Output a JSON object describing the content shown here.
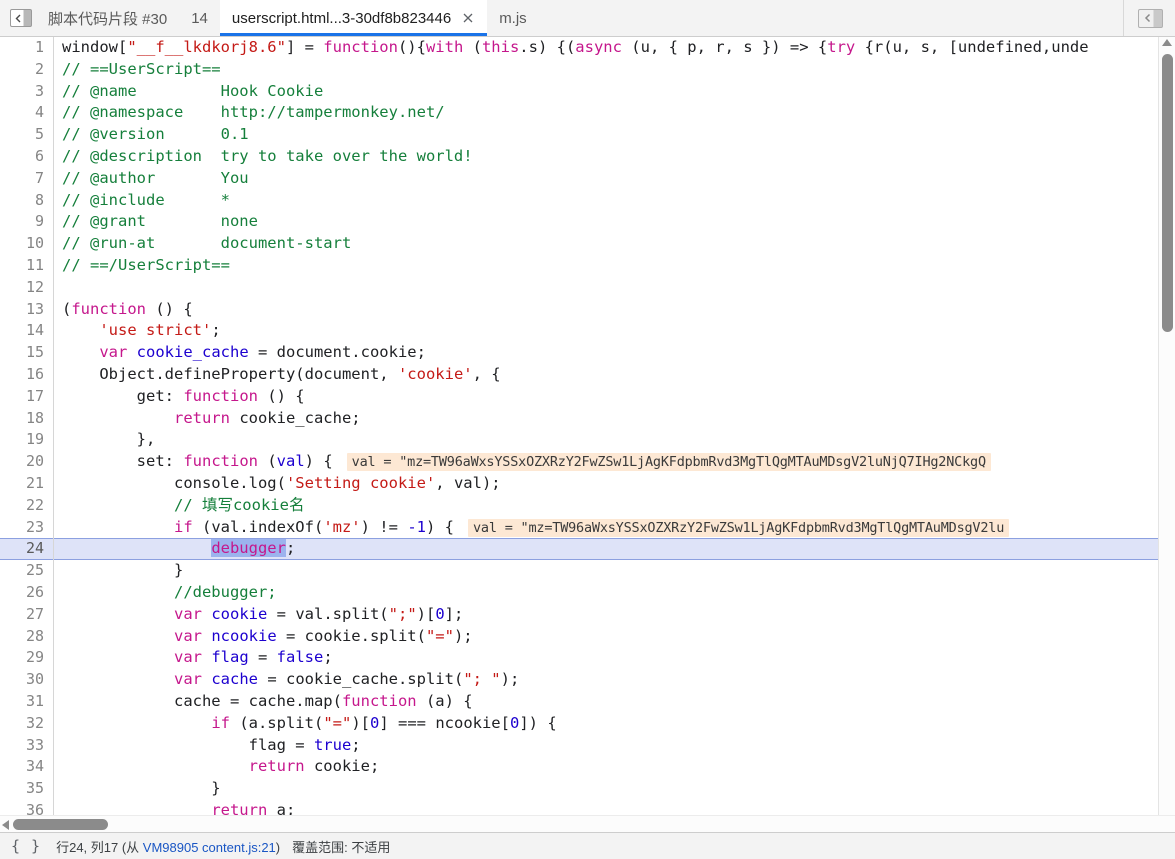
{
  "tabbar": {
    "panel_toggle_icon": "show-navigator-icon",
    "tabs": [
      {
        "label": "脚本代码片段 #30",
        "active": false,
        "closable": false
      },
      {
        "label": "14",
        "active": false,
        "closable": false
      },
      {
        "label": "userscript.html...3-30df8b823446",
        "active": true,
        "closable": true
      },
      {
        "label": "m.js",
        "active": false,
        "closable": false
      }
    ],
    "close_glyph": "✕",
    "collapse_icon": "collapse-sidebar-icon"
  },
  "editor": {
    "current_line": 24,
    "lines": [
      {
        "n": "1",
        "tokens": [
          {
            "t": "window[",
            "c": "t-plain"
          },
          {
            "t": "\"__f__lkdkorj8.6\"",
            "c": "t-str"
          },
          {
            "t": "] = ",
            "c": "t-plain"
          },
          {
            "t": "function",
            "c": "t-kw"
          },
          {
            "t": "(){",
            "c": "t-plain"
          },
          {
            "t": "with",
            "c": "t-kw"
          },
          {
            "t": " (",
            "c": "t-plain"
          },
          {
            "t": "this",
            "c": "t-kw"
          },
          {
            "t": ".s) {(",
            "c": "t-plain"
          },
          {
            "t": "async",
            "c": "t-kw"
          },
          {
            "t": " (u, { p, r, s }) => {",
            "c": "t-plain"
          },
          {
            "t": "try",
            "c": "t-kw"
          },
          {
            "t": " {r(u, s, [undefined,unde",
            "c": "t-plain"
          }
        ]
      },
      {
        "n": "2",
        "tokens": [
          {
            "t": "// ==UserScript==",
            "c": "t-cmt"
          }
        ]
      },
      {
        "n": "3",
        "tokens": [
          {
            "t": "// @name         Hook Cookie",
            "c": "t-cmt"
          }
        ]
      },
      {
        "n": "4",
        "tokens": [
          {
            "t": "// @namespace    http://tampermonkey.net/",
            "c": "t-cmt"
          }
        ]
      },
      {
        "n": "5",
        "tokens": [
          {
            "t": "// @version      0.1",
            "c": "t-cmt"
          }
        ]
      },
      {
        "n": "6",
        "tokens": [
          {
            "t": "// @description  try to take over the world!",
            "c": "t-cmt"
          }
        ]
      },
      {
        "n": "7",
        "tokens": [
          {
            "t": "// @author       You",
            "c": "t-cmt"
          }
        ]
      },
      {
        "n": "8",
        "tokens": [
          {
            "t": "// @include      *",
            "c": "t-cmt"
          }
        ]
      },
      {
        "n": "9",
        "tokens": [
          {
            "t": "// @grant        none",
            "c": "t-cmt"
          }
        ]
      },
      {
        "n": "10",
        "tokens": [
          {
            "t": "// @run-at       document-start",
            "c": "t-cmt"
          }
        ]
      },
      {
        "n": "11",
        "tokens": [
          {
            "t": "// ==/UserScript==",
            "c": "t-cmt"
          }
        ]
      },
      {
        "n": "12",
        "tokens": [
          {
            "t": "",
            "c": "t-plain"
          }
        ]
      },
      {
        "n": "13",
        "tokens": [
          {
            "t": "(",
            "c": "t-plain"
          },
          {
            "t": "function",
            "c": "t-kw"
          },
          {
            "t": " () {",
            "c": "t-plain"
          }
        ]
      },
      {
        "n": "14",
        "tokens": [
          {
            "t": "    ",
            "c": "t-plain"
          },
          {
            "t": "'use strict'",
            "c": "t-str"
          },
          {
            "t": ";",
            "c": "t-plain"
          }
        ]
      },
      {
        "n": "15",
        "tokens": [
          {
            "t": "    ",
            "c": "t-plain"
          },
          {
            "t": "var",
            "c": "t-kw"
          },
          {
            "t": " ",
            "c": "t-plain"
          },
          {
            "t": "cookie_cache",
            "c": "t-var"
          },
          {
            "t": " = document.cookie;",
            "c": "t-plain"
          }
        ]
      },
      {
        "n": "16",
        "tokens": [
          {
            "t": "    Object.defineProperty(document, ",
            "c": "t-plain"
          },
          {
            "t": "'cookie'",
            "c": "t-str"
          },
          {
            "t": ", {",
            "c": "t-plain"
          }
        ]
      },
      {
        "n": "17",
        "tokens": [
          {
            "t": "        get: ",
            "c": "t-plain"
          },
          {
            "t": "function",
            "c": "t-kw"
          },
          {
            "t": " () {",
            "c": "t-plain"
          }
        ]
      },
      {
        "n": "18",
        "tokens": [
          {
            "t": "            ",
            "c": "t-plain"
          },
          {
            "t": "return",
            "c": "t-kw"
          },
          {
            "t": " cookie_cache;",
            "c": "t-plain"
          }
        ]
      },
      {
        "n": "19",
        "tokens": [
          {
            "t": "        },",
            "c": "t-plain"
          }
        ]
      },
      {
        "n": "20",
        "tokens": [
          {
            "t": "        set: ",
            "c": "t-plain"
          },
          {
            "t": "function",
            "c": "t-kw"
          },
          {
            "t": " (",
            "c": "t-plain"
          },
          {
            "t": "val",
            "c": "t-var"
          },
          {
            "t": ") {",
            "c": "t-plain"
          }
        ],
        "hint": "val = \"mz=TW96aWxsYSSxOZXRzY2FwZSw1LjAgKFdpbmRvd3MgTlQgMTAuMDsgV2luNjQ7IHg2NCkgQ"
      },
      {
        "n": "21",
        "tokens": [
          {
            "t": "            console.log(",
            "c": "t-plain"
          },
          {
            "t": "'Setting cookie'",
            "c": "t-str"
          },
          {
            "t": ", val);",
            "c": "t-plain"
          }
        ]
      },
      {
        "n": "22",
        "tokens": [
          {
            "t": "            // 填写cookie名",
            "c": "t-cmt"
          }
        ]
      },
      {
        "n": "23",
        "tokens": [
          {
            "t": "            ",
            "c": "t-plain"
          },
          {
            "t": "if",
            "c": "t-kw"
          },
          {
            "t": " (val.indexOf(",
            "c": "t-plain"
          },
          {
            "t": "'mz'",
            "c": "t-str"
          },
          {
            "t": ") != ",
            "c": "t-plain"
          },
          {
            "t": "-1",
            "c": "t-num"
          },
          {
            "t": ") {",
            "c": "t-plain"
          }
        ],
        "hint": "val = \"mz=TW96aWxsYSSxOZXRzY2FwZSw1LjAgKFdpbmRvd3MgTlQgMTAuMDsgV2lu"
      },
      {
        "n": "24",
        "tokens": [
          {
            "t": "                ",
            "c": "t-plain"
          },
          {
            "t": "debugger",
            "c": "t-kw sel"
          },
          {
            "t": ";",
            "c": "t-plain"
          }
        ]
      },
      {
        "n": "25",
        "tokens": [
          {
            "t": "            }",
            "c": "t-plain"
          }
        ]
      },
      {
        "n": "26",
        "tokens": [
          {
            "t": "            //debugger;",
            "c": "t-cmt"
          }
        ]
      },
      {
        "n": "27",
        "tokens": [
          {
            "t": "            ",
            "c": "t-plain"
          },
          {
            "t": "var",
            "c": "t-kw"
          },
          {
            "t": " ",
            "c": "t-plain"
          },
          {
            "t": "cookie",
            "c": "t-var"
          },
          {
            "t": " = val.split(",
            "c": "t-plain"
          },
          {
            "t": "\";\"",
            "c": "t-str"
          },
          {
            "t": ")[",
            "c": "t-plain"
          },
          {
            "t": "0",
            "c": "t-num"
          },
          {
            "t": "];",
            "c": "t-plain"
          }
        ]
      },
      {
        "n": "28",
        "tokens": [
          {
            "t": "            ",
            "c": "t-plain"
          },
          {
            "t": "var",
            "c": "t-kw"
          },
          {
            "t": " ",
            "c": "t-plain"
          },
          {
            "t": "ncookie",
            "c": "t-var"
          },
          {
            "t": " = cookie.split(",
            "c": "t-plain"
          },
          {
            "t": "\"=\"",
            "c": "t-str"
          },
          {
            "t": ");",
            "c": "t-plain"
          }
        ]
      },
      {
        "n": "29",
        "tokens": [
          {
            "t": "            ",
            "c": "t-plain"
          },
          {
            "t": "var",
            "c": "t-kw"
          },
          {
            "t": " ",
            "c": "t-plain"
          },
          {
            "t": "flag",
            "c": "t-var"
          },
          {
            "t": " = ",
            "c": "t-plain"
          },
          {
            "t": "false",
            "c": "t-num"
          },
          {
            "t": ";",
            "c": "t-plain"
          }
        ]
      },
      {
        "n": "30",
        "tokens": [
          {
            "t": "            ",
            "c": "t-plain"
          },
          {
            "t": "var",
            "c": "t-kw"
          },
          {
            "t": " ",
            "c": "t-plain"
          },
          {
            "t": "cache",
            "c": "t-var"
          },
          {
            "t": " = cookie_cache.split(",
            "c": "t-plain"
          },
          {
            "t": "\"; \"",
            "c": "t-str"
          },
          {
            "t": ");",
            "c": "t-plain"
          }
        ]
      },
      {
        "n": "31",
        "tokens": [
          {
            "t": "            cache = cache.map(",
            "c": "t-plain"
          },
          {
            "t": "function",
            "c": "t-kw"
          },
          {
            "t": " (a) {",
            "c": "t-plain"
          }
        ]
      },
      {
        "n": "32",
        "tokens": [
          {
            "t": "                ",
            "c": "t-plain"
          },
          {
            "t": "if",
            "c": "t-kw"
          },
          {
            "t": " (a.split(",
            "c": "t-plain"
          },
          {
            "t": "\"=\"",
            "c": "t-str"
          },
          {
            "t": ")[",
            "c": "t-plain"
          },
          {
            "t": "0",
            "c": "t-num"
          },
          {
            "t": "] === ncookie[",
            "c": "t-plain"
          },
          {
            "t": "0",
            "c": "t-num"
          },
          {
            "t": "]) {",
            "c": "t-plain"
          }
        ]
      },
      {
        "n": "33",
        "tokens": [
          {
            "t": "                    flag = ",
            "c": "t-plain"
          },
          {
            "t": "true",
            "c": "t-num"
          },
          {
            "t": ";",
            "c": "t-plain"
          }
        ]
      },
      {
        "n": "34",
        "tokens": [
          {
            "t": "                    ",
            "c": "t-plain"
          },
          {
            "t": "return",
            "c": "t-kw"
          },
          {
            "t": " cookie;",
            "c": "t-plain"
          }
        ]
      },
      {
        "n": "35",
        "tokens": [
          {
            "t": "                }",
            "c": "t-plain"
          }
        ]
      },
      {
        "n": "36",
        "tokens": [
          {
            "t": "                ",
            "c": "t-plain"
          },
          {
            "t": "return",
            "c": "t-kw"
          },
          {
            "t": " a;",
            "c": "t-plain"
          }
        ]
      }
    ]
  },
  "statusbar": {
    "pretty_print_icon": "{ }",
    "position": "行24, 列17 (从 ",
    "source_link": "VM98905 content.js:21",
    "position_suffix": ")",
    "coverage": "覆盖范围: 不适用"
  },
  "colors": {
    "accent": "#1a73e8",
    "current_line": "#dee3f8",
    "inline_hint_bg": "#fde8d4",
    "selection": "#9cb3ee"
  }
}
